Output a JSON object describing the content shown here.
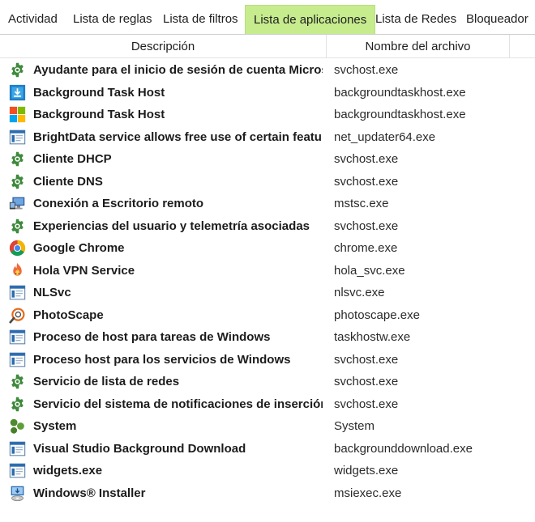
{
  "tabs": [
    {
      "label": "Actividad"
    },
    {
      "label": "Lista de reglas"
    },
    {
      "label": "Lista de filtros"
    },
    {
      "label": "Lista de aplicaciones"
    },
    {
      "label": "Lista de Redes"
    },
    {
      "label": "Bloqueador"
    }
  ],
  "active_tab": "Lista de aplicaciones",
  "columns": {
    "description": "Descripción",
    "filename": "Nombre del archivo"
  },
  "rows": [
    {
      "icon": "gear-icon",
      "description": "Ayudante para el inicio de sesión de cuenta Micros",
      "filename": "svchost.exe"
    },
    {
      "icon": "background-task-icon",
      "description": "Background Task Host",
      "filename": "backgroundtaskhost.exe"
    },
    {
      "icon": "windows-logo-icon",
      "description": "Background Task Host",
      "filename": "backgroundtaskhost.exe"
    },
    {
      "icon": "app-window-icon",
      "description": "BrightData service allows free use of certain featu",
      "filename": "net_updater64.exe"
    },
    {
      "icon": "gear-icon",
      "description": "Cliente DHCP",
      "filename": "svchost.exe"
    },
    {
      "icon": "gear-icon",
      "description": "Cliente DNS",
      "filename": "svchost.exe"
    },
    {
      "icon": "remote-desktop-icon",
      "description": "Conexión a Escritorio remoto",
      "filename": "mstsc.exe"
    },
    {
      "icon": "gear-icon",
      "description": "Experiencias del usuario y telemetría asociadas",
      "filename": "svchost.exe"
    },
    {
      "icon": "chrome-icon",
      "description": "Google Chrome",
      "filename": "chrome.exe"
    },
    {
      "icon": "hola-vpn-icon",
      "description": "Hola VPN Service",
      "filename": "hola_svc.exe"
    },
    {
      "icon": "app-window-icon",
      "description": "NLSvc",
      "filename": "nlsvc.exe"
    },
    {
      "icon": "photoscape-icon",
      "description": "PhotoScape",
      "filename": "photoscape.exe"
    },
    {
      "icon": "app-window-icon",
      "description": "Proceso de host para tareas de Windows",
      "filename": "taskhostw.exe"
    },
    {
      "icon": "app-window-icon",
      "description": "Proceso host para los servicios de Windows",
      "filename": "svchost.exe"
    },
    {
      "icon": "gear-icon",
      "description": "Servicio de lista de redes",
      "filename": "svchost.exe"
    },
    {
      "icon": "gear-icon",
      "description": "Servicio del sistema de notificaciones de inserción",
      "filename": "svchost.exe"
    },
    {
      "icon": "system-icon",
      "description": "System",
      "filename": "System"
    },
    {
      "icon": "app-window-icon",
      "description": "Visual Studio Background Download",
      "filename": "backgrounddownload.exe"
    },
    {
      "icon": "app-window-icon",
      "description": "widgets.exe",
      "filename": "widgets.exe"
    },
    {
      "icon": "windows-installer-icon",
      "description": "Windows® Installer",
      "filename": "msiexec.exe"
    }
  ],
  "colors": {
    "active_tab": "#c6ec8e",
    "gear": "#3f8a3c"
  }
}
